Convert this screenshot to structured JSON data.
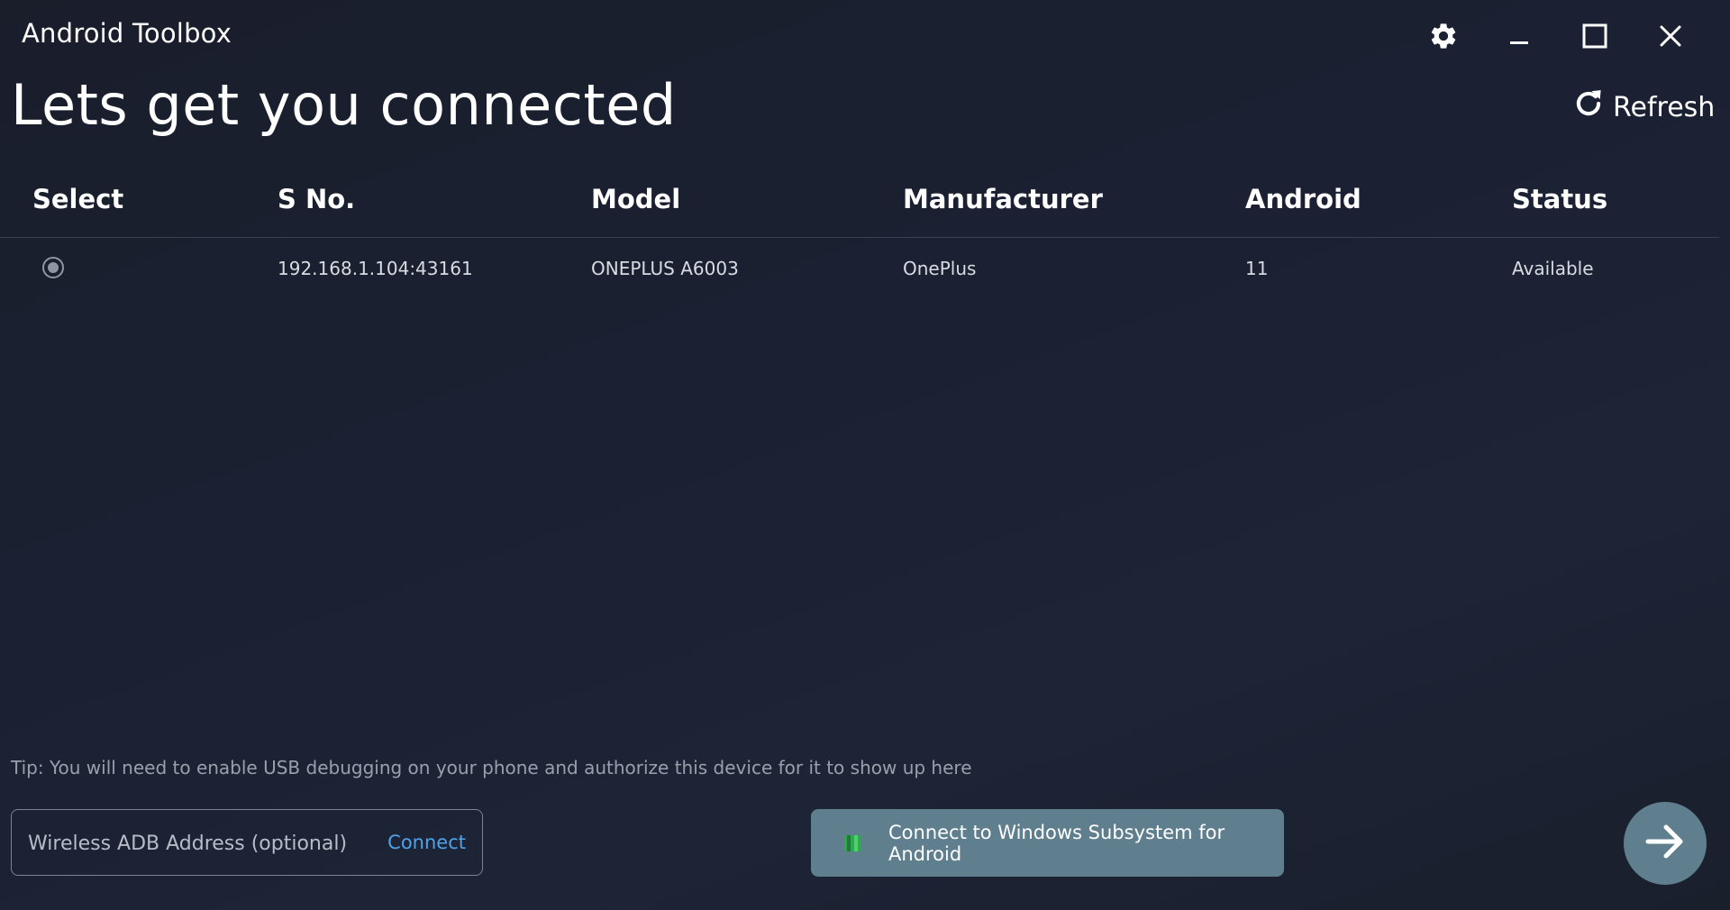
{
  "window": {
    "title": "Android Toolbox",
    "controls": {
      "settings_icon": "gear-icon",
      "minimize_icon": "minimize-icon",
      "maximize_icon": "maximize-icon",
      "close_icon": "close-icon"
    }
  },
  "header": {
    "title": "Lets get you connected",
    "refresh_label": "Refresh",
    "refresh_icon": "refresh-icon"
  },
  "table": {
    "columns": {
      "select": "Select",
      "sno": "S No.",
      "model": "Model",
      "manufacturer": "Manufacturer",
      "android": "Android",
      "status": "Status"
    },
    "rows": [
      {
        "selected": true,
        "sno": "192.168.1.104:43161",
        "model": "ONEPLUS A6003",
        "manufacturer": "OnePlus",
        "android": "11",
        "status": "Available"
      }
    ]
  },
  "footer": {
    "tip": "Tip: You will need to enable USB debugging on your phone and authorize this device for it to show up here",
    "wireless": {
      "placeholder": "Wireless ADB Address (optional)",
      "value": "",
      "connect_label": "Connect"
    },
    "wsa_button_label": "Connect to Windows Subsystem for Android",
    "wsa_icon": "windows-subsystem-icon",
    "next_icon": "arrow-right-icon"
  },
  "colors": {
    "background": "#1b2133",
    "accent_button": "#5f7f8f",
    "link": "#4ea3ea",
    "divider": "#3a4050"
  }
}
